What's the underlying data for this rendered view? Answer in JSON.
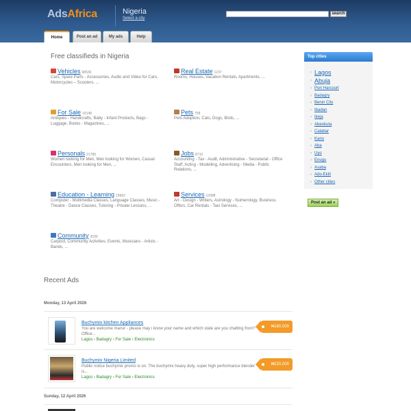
{
  "header": {
    "logo_part1": "Ads",
    "logo_part2": "Africa",
    "country": "Nigeria",
    "select_city": "Select a city",
    "search_button": "search"
  },
  "tabs": [
    "Home",
    "Post an ad",
    "My ads",
    "Help"
  ],
  "main": {
    "title": "Free classifieds in Nigeria",
    "categories": [
      {
        "name": "Vehicles",
        "count": "68530",
        "desc": "Cars, Spare Parts - Accessories, Audio and Video for Cars, Motorcycles – Scooters, ...",
        "icon": "car-icon",
        "color": "#d9453a"
      },
      {
        "name": "Real Estate",
        "count": "1237",
        "desc": "Rooms, Houses, Vacation Rentals, Apartments, ...",
        "icon": "house-icon",
        "color": "#c0392b"
      },
      {
        "name": "For Sale",
        "count": "10148",
        "desc": "Antiques - Handicrafts, Baby - Infant Products, Bags - Luggage, Books - Magazines, ...",
        "icon": "tag-icon",
        "color": "#e0a030"
      },
      {
        "name": "Pets",
        "count": "758",
        "desc": "Pets Adoption, Cats, Dogs, Birds, ...",
        "icon": "paw-icon",
        "color": "#b08050"
      },
      {
        "name": "Personals",
        "count": "21789",
        "desc": "Women looking for Men, Men looking for Women, Casual Encounters, Men looking for Men, ...",
        "icon": "heart-icon",
        "color": "#d6336c"
      },
      {
        "name": "Jobs",
        "count": "8710",
        "desc": "Accounting - Tax - Audit, Administrative - Secretarial - Office Staff, Acting - Modelling, Advertising - Media - Public Relations, ...",
        "icon": "briefcase-icon",
        "color": "#8a5a2a"
      },
      {
        "name": "Education - Learning",
        "count": "15662",
        "desc": "Computer - Multimedia Classes, Language Classes, Music - Theatre - Dance Classes, Tutoring - Private Lessons, ...",
        "icon": "book-icon",
        "color": "#4a6fa0"
      },
      {
        "name": "Services",
        "count": "12998",
        "desc": "Art - Design - Writers, Astrology - Numerology, Business Offers, Car Rentals - Taxi Services, ...",
        "icon": "tools-icon",
        "color": "#c0392b"
      },
      {
        "name": "Community",
        "count": "2039",
        "desc": "Carpool, Community Activities, Events, Musicians - Artists - Bands, ...",
        "icon": "people-icon",
        "color": "#3a7ac0"
      }
    ]
  },
  "recent": {
    "title": "Recent Ads",
    "groups": [
      {
        "date": "Monday, 13 April 2026",
        "ads": [
          {
            "title": "Buchymix kitchen Appliances",
            "desc": "You are welcome marsir - please may i know your name and which state are you chatting from? Office...",
            "crumbs": "Lagos › Badagry › For Sale › Electronics",
            "price": "₦180,000"
          },
          {
            "title": "Buchymix Nigeria Limited",
            "desc": "Public notice buchymix promo is on. The buchymix heavy duty, super high performance blender is...",
            "crumbs": "Lagos › Badagry › For Sale › Electronics",
            "price": "₦220,000"
          }
        ]
      },
      {
        "date": "Sunday, 12 April 2026",
        "ads": []
      }
    ]
  },
  "sidebar": {
    "title": "Top cities",
    "cities": [
      "Lagos",
      "Abuja",
      "Port Harcourt",
      "Badagry",
      "Benin City",
      "Ibadan",
      "Ikeja",
      "Abeokuta",
      "Calabar",
      "Kano",
      "Aba",
      "Uyo",
      "Enugu",
      "Asaba",
      "Ado-Ekiti",
      "Other cities"
    ],
    "post_button": "Post an ad »"
  }
}
